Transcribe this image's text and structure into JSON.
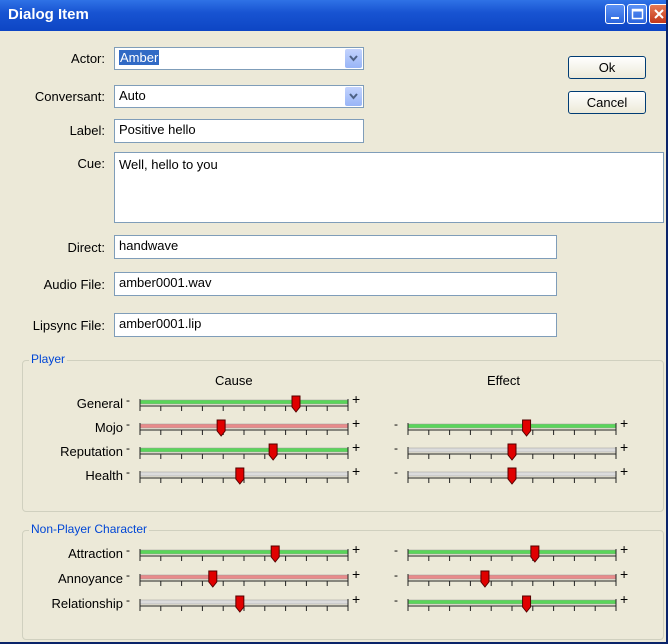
{
  "window": {
    "title": "Dialog Item"
  },
  "form": {
    "actor_label": "Actor:",
    "actor_value": "Amber",
    "conversant_label": "Conversant:",
    "conversant_value": "Auto",
    "label_label": "Label:",
    "label_value": "Positive hello",
    "cue_label": "Cue:",
    "cue_value": "Well, hello to you",
    "direct_label": "Direct:",
    "direct_value": "handwave",
    "audio_label": "Audio File:",
    "audio_value": "amber0001.wav",
    "lipsync_label": "Lipsync File:",
    "lipsync_value": "amber0001.lip"
  },
  "buttons": {
    "ok": "Ok",
    "cancel": "Cancel"
  },
  "player_group": {
    "title": "Player",
    "cause_header": "Cause",
    "effect_header": "Effect",
    "rows": [
      {
        "label": "General",
        "cause": 0.75,
        "cause_color": "#5ad55a",
        "effect": null
      },
      {
        "label": "Mojo",
        "cause": 0.39,
        "cause_color": "#e88b8b",
        "effect": 0.57,
        "effect_color": "#5ad55a"
      },
      {
        "label": "Reputation",
        "cause": 0.64,
        "cause_color": "#5ad55a",
        "effect": 0.5,
        "effect_color": "#dcdcdc"
      },
      {
        "label": "Health",
        "cause": 0.48,
        "cause_color": "#dcdcdc",
        "effect": 0.5,
        "effect_color": "#dcdcdc"
      }
    ]
  },
  "npc_group": {
    "title": "Non-Player Character",
    "rows": [
      {
        "label": "Attraction",
        "cause": 0.65,
        "cause_color": "#5ad55a",
        "effect": 0.61,
        "effect_color": "#5ad55a"
      },
      {
        "label": "Annoyance",
        "cause": 0.35,
        "cause_color": "#e88b8b",
        "effect": 0.37,
        "effect_color": "#e88b8b"
      },
      {
        "label": "Relationship",
        "cause": 0.48,
        "cause_color": "#dcdcdc",
        "effect": 0.57,
        "effect_color": "#5ad55a"
      }
    ]
  },
  "slider_symbols": {
    "minus": "-",
    "plus": "+"
  },
  "colors": {
    "titlebar": "#1854d2",
    "group_title": "#0046d5",
    "thumb": "#e00000"
  }
}
